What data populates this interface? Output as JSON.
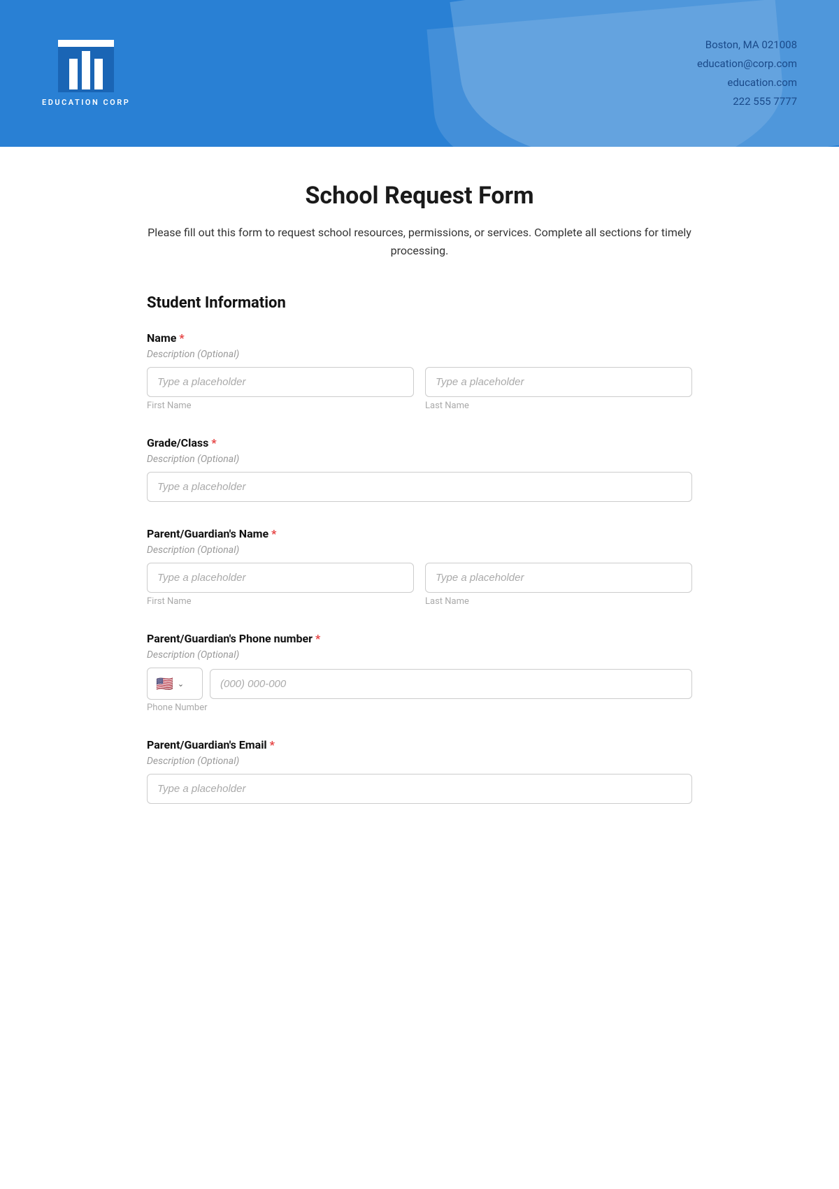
{
  "header": {
    "logo_text": "EDUCATION CORP",
    "address": "Boston, MA 021008",
    "email": "education@corp.com",
    "website": "education.com",
    "phone": "222 555 7777"
  },
  "form": {
    "title": "School Request Form",
    "subtitle": "Please fill out this form to request school resources, permissions, or services. Complete all sections for timely processing.",
    "section_student": "Student Information",
    "fields": {
      "name": {
        "label": "Name",
        "required": true,
        "description": "Description (Optional)",
        "first_placeholder": "Type a placeholder",
        "last_placeholder": "Type a placeholder",
        "first_label": "First Name",
        "last_label": "Last Name"
      },
      "grade": {
        "label": "Grade/Class",
        "required": true,
        "description": "Description (Optional)",
        "placeholder": "Type a placeholder"
      },
      "guardian_name": {
        "label": "Parent/Guardian's Name",
        "required": true,
        "description": "Description (Optional)",
        "first_placeholder": "Type a placeholder",
        "last_placeholder": "Type a placeholder",
        "first_label": "First Name",
        "last_label": "Last Name"
      },
      "guardian_phone": {
        "label": "Parent/Guardian's Phone number",
        "required": true,
        "description": "Description (Optional)",
        "placeholder": "(000) 000-000",
        "sub_label": "Phone Number",
        "country_flag": "🇺🇸",
        "country_chevron": "∨"
      },
      "guardian_email": {
        "label": "Parent/Guardian's Email",
        "required": true,
        "description": "Description (Optional)",
        "placeholder": "Type a placeholder"
      }
    }
  }
}
